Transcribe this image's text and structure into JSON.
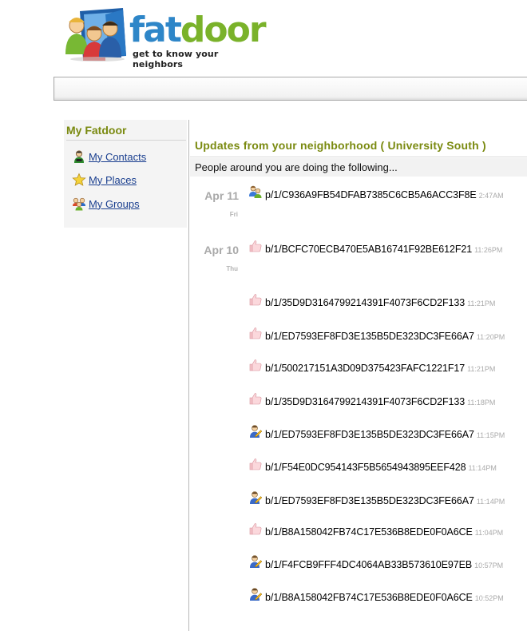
{
  "brand": {
    "name_part1": "fat",
    "name_part2": "door",
    "tagline": "get to know your neighbors",
    "colors": {
      "blue": "#2e86c8",
      "green": "#7ab22a",
      "olive_heading": "#7a8a10",
      "link": "#1a3f8f"
    }
  },
  "sidebar": {
    "title": "My Fatdoor",
    "items": [
      {
        "label": "My Contacts",
        "icon": "contact-person-icon"
      },
      {
        "label": "My Places",
        "icon": "star-icon"
      },
      {
        "label": "My Groups",
        "icon": "group-people-icon"
      }
    ]
  },
  "main": {
    "title": "Updates from your neighborhood ( University South )",
    "subheading": "People around you are doing the following...",
    "groups": [
      {
        "date": "Apr 11",
        "day": "Fri"
      },
      {
        "date": "Apr 10",
        "day": "Thu"
      }
    ],
    "updates": [
      {
        "text": "p/1/C936A9FB54DFAB7385C6CB5A6ACC3F8E",
        "time": "2:47AM",
        "icon": "people-icon"
      },
      {
        "text": "b/1/BCFC70ECB470E5AB16741F92BE612F21",
        "time": "11:26PM",
        "icon": "thumbs-up-icon"
      },
      {
        "text": "b/1/35D9D3164799214391F4073F6CD2F133",
        "time": "11:21PM",
        "icon": "thumbs-up-icon"
      },
      {
        "text": "b/1/ED7593EF8FD3E135B5DE323DC3FE66A7",
        "time": "11:20PM",
        "icon": "thumbs-up-icon"
      },
      {
        "text": "b/1/500217151A3D09D375423FAFC1221F17",
        "time": "11:21PM",
        "icon": "thumbs-up-icon"
      },
      {
        "text": "b/1/35D9D3164799214391F4073F6CD2F133",
        "time": "11:18PM",
        "icon": "thumbs-up-icon"
      },
      {
        "text": "b/1/ED7593EF8FD3E135B5DE323DC3FE66A7",
        "time": "11:15PM",
        "icon": "person-edit-icon"
      },
      {
        "text": "b/1/F54E0DC954143F5B5654943895EEF428",
        "time": "11:14PM",
        "icon": "thumbs-up-icon"
      },
      {
        "text": "b/1/ED7593EF8FD3E135B5DE323DC3FE66A7",
        "time": "11:14PM",
        "icon": "person-edit-icon"
      },
      {
        "text": "b/1/B8A158042FB74C17E536B8EDE0F0A6CE",
        "time": "11:04PM",
        "icon": "thumbs-up-icon"
      },
      {
        "text": "b/1/F4FCB9FFF4DC4064AB33B573610E97EB",
        "time": "10:57PM",
        "icon": "person-edit-icon"
      },
      {
        "text": "b/1/B8A158042FB74C17E536B8EDE0F0A6CE",
        "time": "10:52PM",
        "icon": "person-edit-icon"
      }
    ]
  }
}
